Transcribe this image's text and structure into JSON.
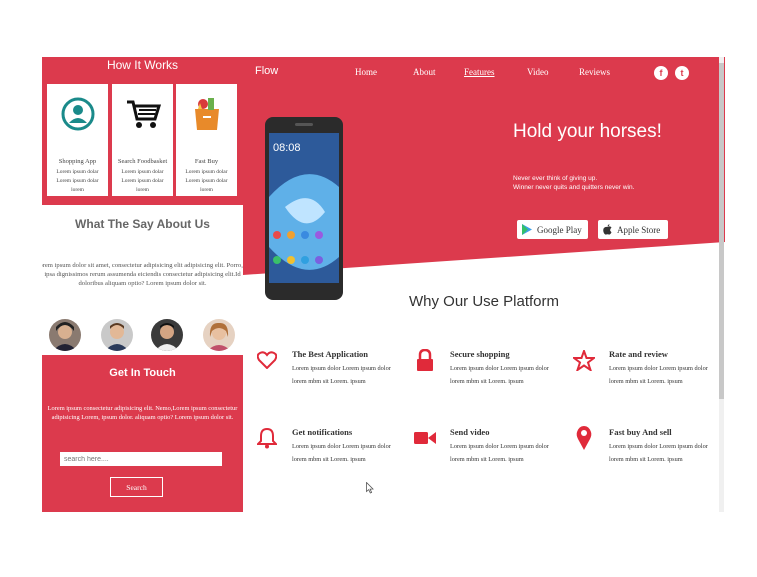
{
  "colors": {
    "accent": "#dc3a4d",
    "white": "#ffffff",
    "text": "#333333"
  },
  "how_it_works": {
    "title": "How It Works",
    "cards": [
      {
        "title": "Shopping App",
        "desc": "Lorem ipsum dolar Lorem ipsum dolar lorem",
        "icon": "user-circle-icon"
      },
      {
        "title": "Search Foodbasket",
        "desc": "Lorem ipsum dolar Lorem ipsum dolar lorem",
        "icon": "cart-icon"
      },
      {
        "title": "Fast Buy",
        "desc": "Lorem ipsum dolar Lorem ipsum dolar lorem",
        "icon": "grocery-bag-icon"
      }
    ]
  },
  "testimonials": {
    "title": "What The Say About Us",
    "text": "Lorem ipsum dolor sit amet, consectetur adipisicing elit adipisicing elit. Porro, id ipsa dignissimos rerum assumenda eiciendis consectetur adipisicing elit.Id doloribus aliquam optio? Lorem ipsum dolor sit."
  },
  "contact": {
    "title": "Get In Touch",
    "text": "Lorem ipsum consectetur adipisicing elit. Nemo,Lorem ipsum consectetur adipisicing Lorem, ipsum dolor. aliquam optio? Lorem ipsum dolor sit.",
    "search_placeholder": "search here....",
    "search_button": "Search"
  },
  "header": {
    "brand": "Flow",
    "nav": [
      "Home",
      "About",
      "Features",
      "Video",
      "Reviews"
    ],
    "social": [
      "f",
      "t"
    ]
  },
  "hero": {
    "title": "Hold your horses!",
    "subtitle_line1": "Never ever think of giving up.",
    "subtitle_line2": "Winner never quits and quitters never win.",
    "phone_time": "08:08",
    "stores": [
      {
        "label": "Google Play",
        "icon": "play-store-icon"
      },
      {
        "label": "Apple Store",
        "icon": "apple-icon"
      }
    ]
  },
  "why": {
    "title": "Why Our Use Platform",
    "features": [
      {
        "title": "The Best Application",
        "desc": "Lorem ipsum dolor Lorem ipsum dolor lorem mbm sit Lorem. ipsum",
        "icon": "heart-icon"
      },
      {
        "title": "Secure shopping",
        "desc": "Lorem ipsum dolor Lorem ipsum dolor lorem mbm sit Lorem. ipsum",
        "icon": "lock-icon"
      },
      {
        "title": "Rate and review",
        "desc": "Lorem ipsum dolor Lorem ipsum dolor lorem mbm sit Lorem. ipsum",
        "icon": "star-icon"
      },
      {
        "title": "Get notifications",
        "desc": "Lorem ipsum dolor Lorem ipsum dolor lorem mbm sit Lorem. ipsum",
        "icon": "bell-icon"
      },
      {
        "title": "Send video",
        "desc": "Lorem ipsum dolor Lorem ipsum dolor lorem mbm sit Lorem. ipsum",
        "icon": "video-camera-icon"
      },
      {
        "title": "Fast buy And sell",
        "desc": "Lorem ipsum dolor Lorem ipsum dolor lorem mbm sit Lorem. ipsum",
        "icon": "location-pin-icon"
      }
    ]
  }
}
